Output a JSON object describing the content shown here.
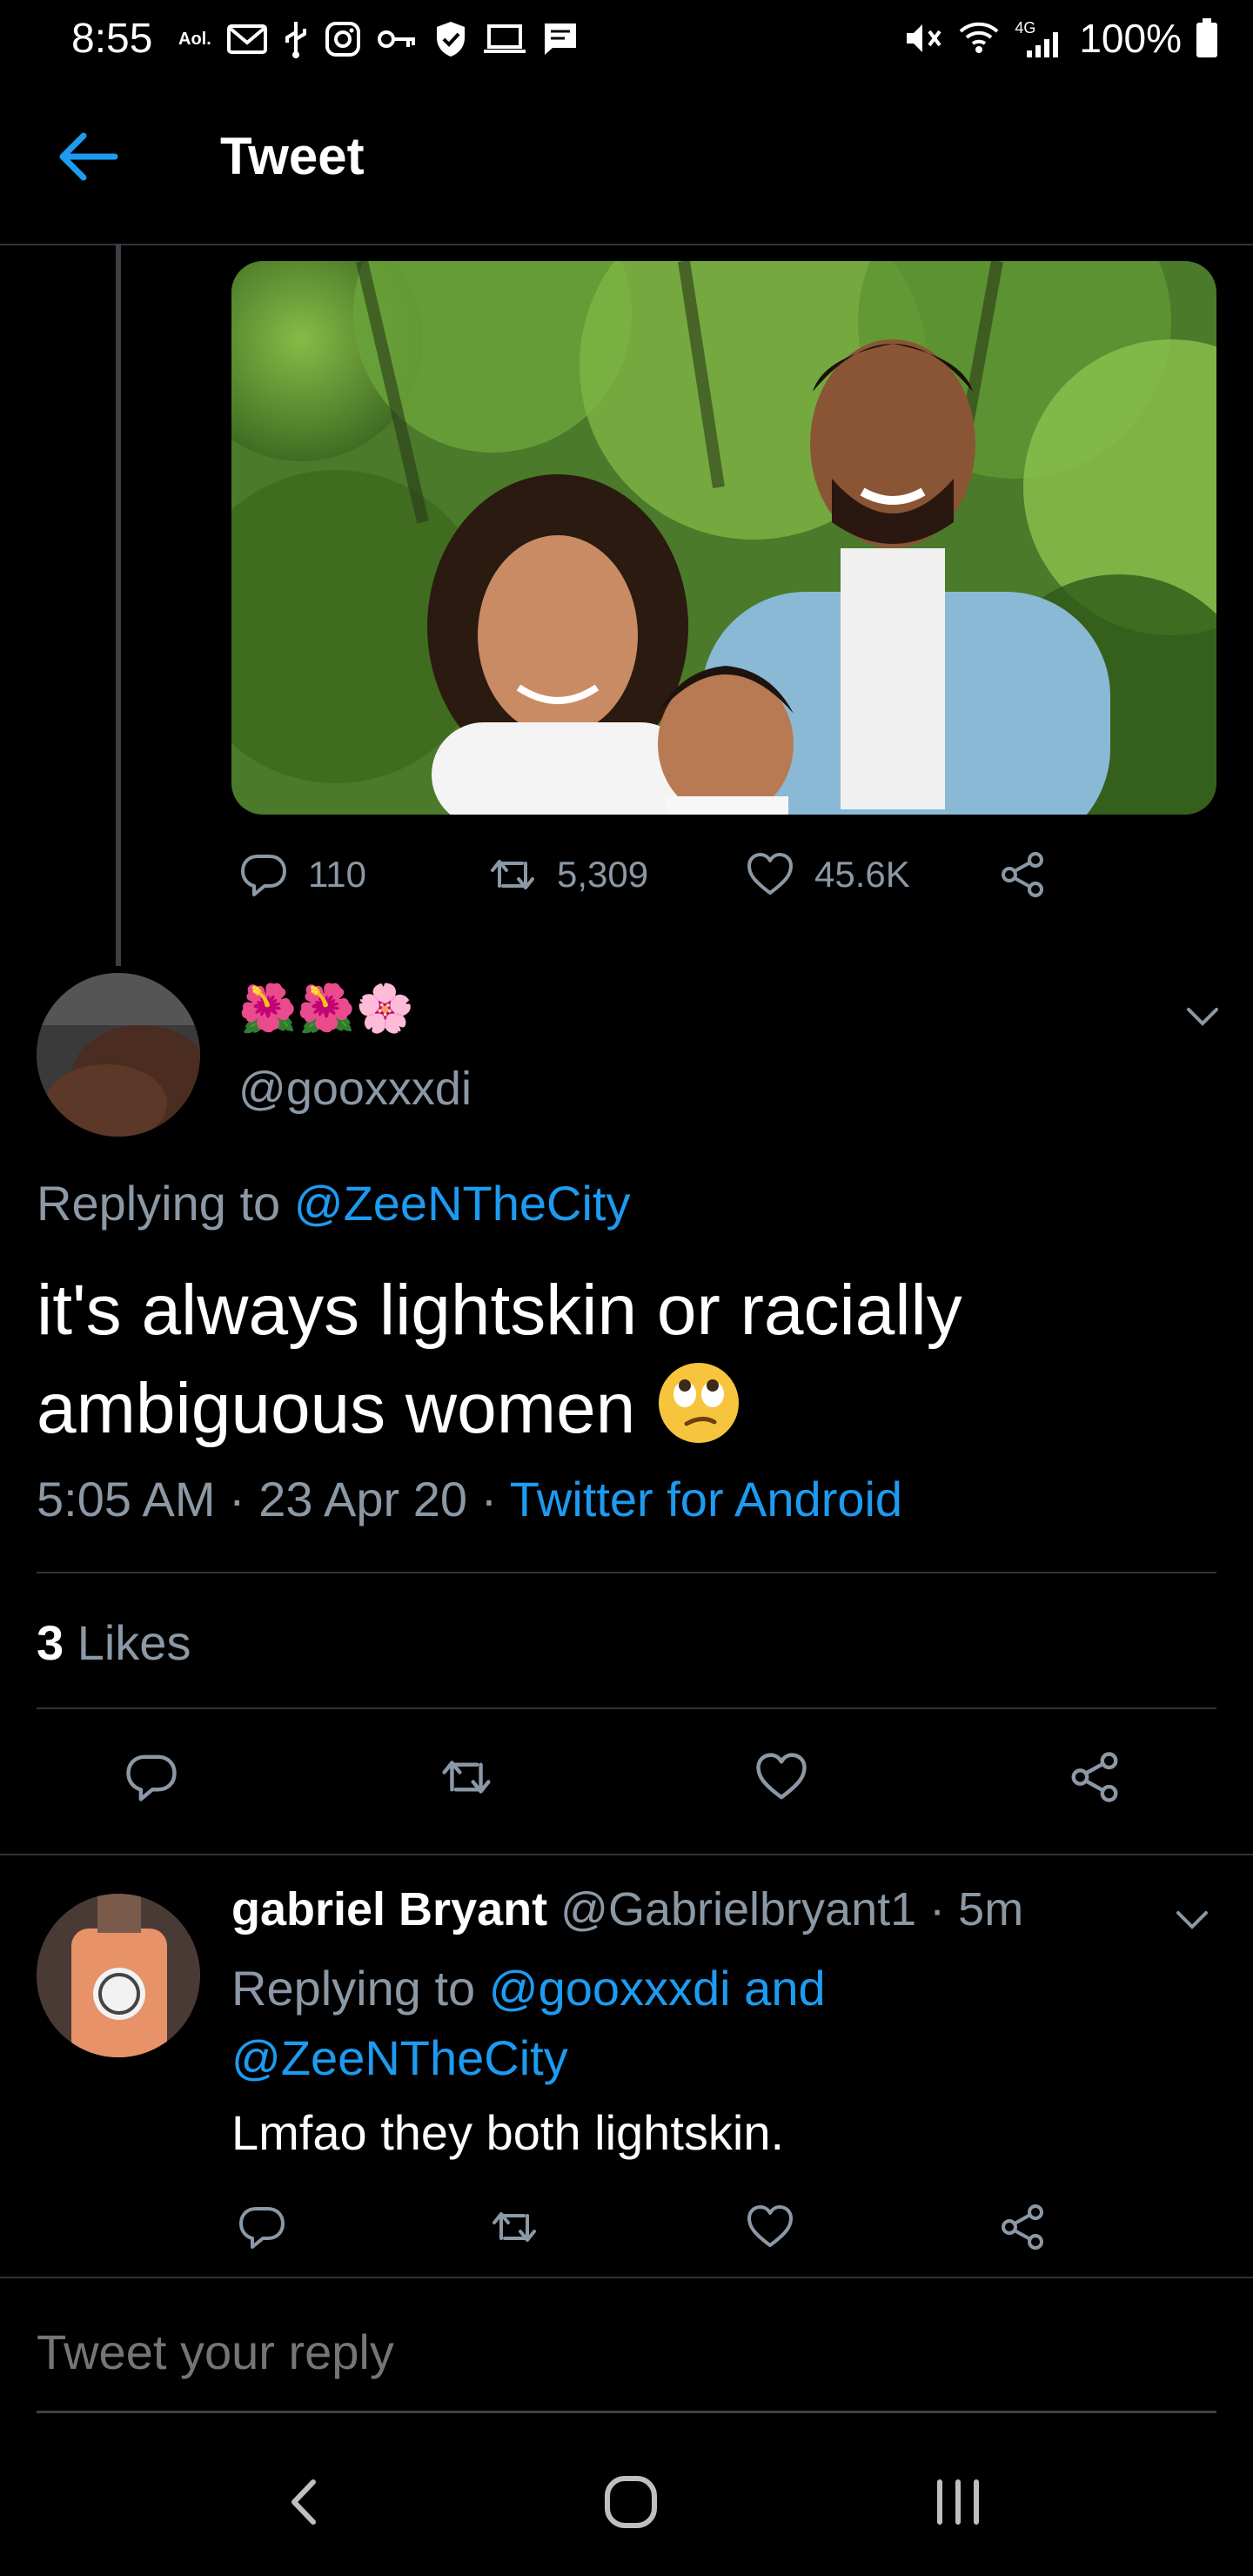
{
  "status_bar": {
    "time": "8:55",
    "aol_label": "Aol.",
    "network": "4G",
    "battery": "100%"
  },
  "header": {
    "title": "Tweet"
  },
  "parent_tweet": {
    "image_alt": "photo of a woman, a man and a toddler in front of trees",
    "stats": {
      "replies": "110",
      "retweets": "5,309",
      "likes": "45.6K"
    }
  },
  "main_tweet": {
    "display_name": "🌺🌺🌸",
    "handle": "@gooxxxdi",
    "replying_prefix": "Replying to",
    "replying_to": "@ZeeNTheCity",
    "text": "it's always lightskin or racially ambiguous women",
    "emoji": "face-with-rolling-eyes",
    "time": "5:05 AM",
    "date": "23 Apr 20",
    "source": "Twitter for Android",
    "likes_count": "3",
    "likes_label": "Likes"
  },
  "reply_tweet": {
    "display_name": "gabriel Bryant",
    "handle": "@Gabrielbryant1",
    "age": "5m",
    "replying_prefix": "Replying to",
    "replying_to_1": "@gooxxxdi",
    "replying_and": "and",
    "replying_to_2": "@ZeeNTheCity",
    "text": "Lmfao they both lightskin."
  },
  "compose": {
    "placeholder": "Tweet your reply"
  },
  "colors": {
    "background": "#000000",
    "accent": "#1d9bf0",
    "secondary_text": "#8b98a5",
    "divider": "#2f3336"
  },
  "icons": [
    "back-arrow-icon",
    "reply-icon",
    "retweet-icon",
    "like-icon",
    "share-icon",
    "chevron-down-icon",
    "nav-back-icon",
    "nav-home-icon",
    "nav-recents-icon"
  ]
}
